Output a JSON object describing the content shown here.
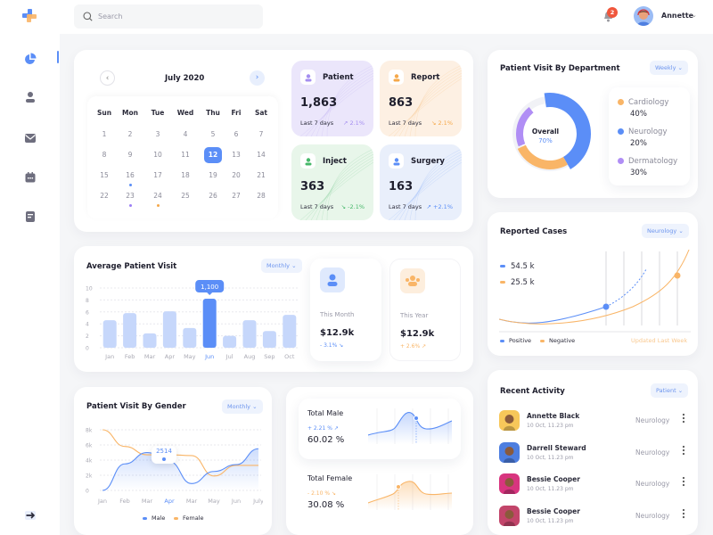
{
  "header": {
    "search_placeholder": "Search",
    "notification_count": "2",
    "user_name": "Annette"
  },
  "sidebar": {
    "items": [
      {
        "name": "dashboard",
        "icon": "pie-chart-icon",
        "active": true
      },
      {
        "name": "patients",
        "icon": "user-icon"
      },
      {
        "name": "messages",
        "icon": "mail-icon"
      },
      {
        "name": "calendar",
        "icon": "calendar-icon"
      },
      {
        "name": "reports",
        "icon": "document-icon"
      }
    ],
    "bottom_icon": "arrow-right-icon"
  },
  "calendar": {
    "month": "July 2020",
    "weekdays": [
      "Sun",
      "Mon",
      "Tue",
      "Wed",
      "Thu",
      "Fri",
      "Sat"
    ],
    "weeks": [
      [
        "1",
        "2",
        "3",
        "4",
        "5",
        "6",
        "7"
      ],
      [
        "8",
        "9",
        "10",
        "11",
        "12",
        "13",
        "14"
      ],
      [
        "15",
        "16",
        "17",
        "18",
        "19",
        "20",
        "21"
      ],
      [
        "22",
        "23",
        "24",
        "25",
        "26",
        "27",
        "28"
      ]
    ],
    "selected": "12",
    "marked": [
      {
        "day": "16",
        "color": "#5b8ef7"
      },
      {
        "day": "23",
        "color": "#9b7ef5"
      },
      {
        "day": "24",
        "color": "#f5a84a"
      }
    ]
  },
  "stats": [
    {
      "label": "Patient",
      "value": "1,863",
      "period": "Last 7 days",
      "change": "2.1%",
      "trend": "up",
      "bg": "#ebe6fb",
      "accent": "#a58ef0"
    },
    {
      "label": "Report",
      "value": "863",
      "period": "Last 7 days",
      "change": "2.1%",
      "trend": "down",
      "bg": "#fdf0e3",
      "accent": "#f5a84a"
    },
    {
      "label": "Inject",
      "value": "363",
      "period": "Last 7 days",
      "change": "-2.1%",
      "trend": "down",
      "bg": "#e8f6ea",
      "accent": "#47b86a"
    },
    {
      "label": "Surgery",
      "value": "163",
      "period": "Last 7 days",
      "change": "+2.1%",
      "trend": "up",
      "bg": "#e9effb",
      "accent": "#5b8ef7"
    }
  ],
  "department": {
    "title": "Patient Visit By Department",
    "filter": "Weekly",
    "center_label": "Overall",
    "center_value": "70%"
  },
  "reported": {
    "title": "Reported Cases",
    "filter": "Neurology",
    "positive_value": "54.5 k",
    "negative_value": "25.5 k",
    "legend_positive": "Positive",
    "legend_negative": "Negative",
    "updated": "Updated Last Week"
  },
  "avg_visit": {
    "title": "Average Patient Visit",
    "filter": "Monthly",
    "tooltip": "1,100"
  },
  "summary": {
    "month_label": "This Month",
    "month_value": "$12.9k",
    "month_change": "- 3.1%",
    "year_label": "This Year",
    "year_value": "$12.9k",
    "year_change": "+ 2.6%"
  },
  "gender": {
    "title": "Patient Visit By Gender",
    "filter": "Monthly",
    "tooltip": "2514",
    "legend_male": "Male",
    "legend_female": "Female"
  },
  "totals": {
    "male_label": "Total Male",
    "male_change": "+ 2.21 %",
    "male_value": "60.02 %",
    "female_label": "Total Female",
    "female_change": "- 2.10 %",
    "female_value": "30.08 %"
  },
  "activity": {
    "title": "Recent Activity",
    "filter": "Patient",
    "items": [
      {
        "name": "Annette Black",
        "time": "10 Oct, 11.23 pm",
        "department": "Neurology",
        "color": "#f7c75a"
      },
      {
        "name": "Darrell Steward",
        "time": "10 Oct, 11.23 pm",
        "department": "Neurology",
        "color": "#4d7ee0"
      },
      {
        "name": "Bessie Cooper",
        "time": "10 Oct, 11.23 pm",
        "department": "Neurology",
        "color": "#d8357f"
      },
      {
        "name": "Bessie Cooper",
        "time": "10 Oct, 11.23 pm",
        "department": "Neurology",
        "color": "#c2456a"
      }
    ]
  },
  "chart_data": [
    {
      "type": "pie",
      "title": "Patient Visit By Department",
      "categories": [
        "Cardiology",
        "Neurology",
        "Dermatology"
      ],
      "values": [
        40,
        20,
        30
      ],
      "colors": [
        "#f9b567",
        "#5b8ef7",
        "#b08ef5"
      ],
      "center": {
        "label": "Overall",
        "value": "70%"
      }
    },
    {
      "type": "bar",
      "title": "Average Patient Visit",
      "categories": [
        "Jan",
        "Feb",
        "Mar",
        "Apr",
        "May",
        "Jun",
        "Jul",
        "Aug",
        "Sep",
        "Oct"
      ],
      "values": [
        4.6,
        5.8,
        2.4,
        6.1,
        3.3,
        8.2,
        2.0,
        4.6,
        2.8,
        5.5
      ],
      "highlight": "Jun",
      "ylim": [
        0,
        10
      ],
      "yticks": [
        0,
        2,
        4,
        6,
        8,
        10
      ],
      "annotation": "1,100"
    },
    {
      "type": "line",
      "title": "Patient Visit By Gender",
      "categories": [
        "Jan",
        "Feb",
        "Mar",
        "Apr",
        "Mar",
        "May",
        "Jun",
        "July"
      ],
      "series": [
        {
          "name": "Male",
          "values": [
            0,
            3500,
            5000,
            3800,
            900,
            2500,
            3400,
            5500
          ],
          "color": "#5b8ef7"
        },
        {
          "name": "Female",
          "values": [
            8000,
            5800,
            4700,
            4700,
            4600,
            1900,
            3300,
            3300
          ],
          "color": "#f9b567"
        }
      ],
      "ylim": [
        0,
        8000
      ],
      "yticks": [
        "0",
        "2k",
        "4k",
        "6k",
        "8k"
      ],
      "highlight": "Apr",
      "annotation": "2514"
    },
    {
      "type": "line",
      "title": "Reported Cases",
      "series": [
        {
          "name": "Positive",
          "total": "54.5 k",
          "color": "#5b8ef7"
        },
        {
          "name": "Negative",
          "total": "25.5 k",
          "color": "#f9b567"
        }
      ]
    }
  ]
}
